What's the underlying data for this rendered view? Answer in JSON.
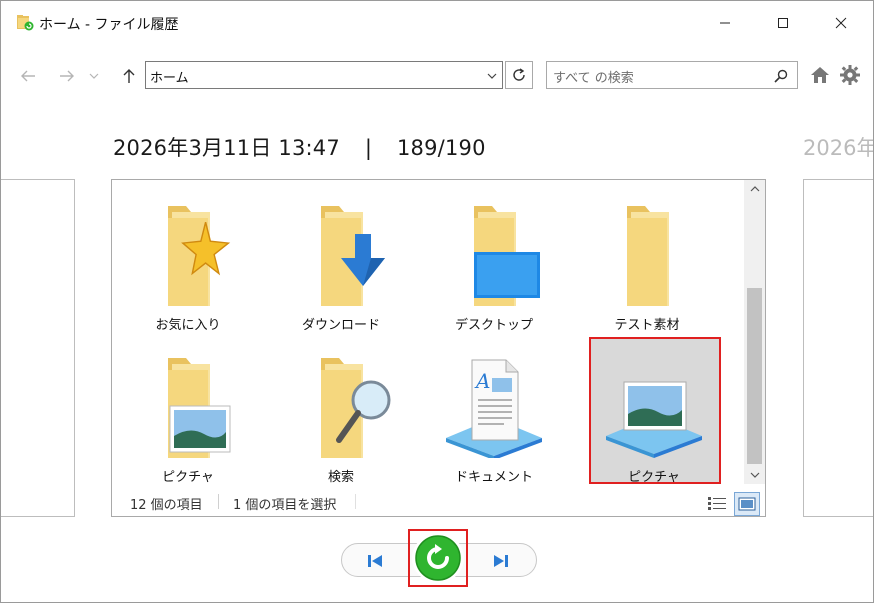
{
  "window": {
    "title": "ホーム - ファイル履歴"
  },
  "nav": {
    "address": "ホーム",
    "search_placeholder": "すべて の検索"
  },
  "snapshot": {
    "datetime": "2026年3月11日 13:47",
    "separator": "|",
    "position": "189/190",
    "next_preview": "2026年"
  },
  "items": [
    {
      "label": "お気に入り",
      "icon": "favorites-folder-icon"
    },
    {
      "label": "ダウンロード",
      "icon": "downloads-folder-icon"
    },
    {
      "label": "デスクトップ",
      "icon": "desktop-folder-icon"
    },
    {
      "label": "テスト素材",
      "icon": "folder-icon"
    },
    {
      "label": "ピクチャ",
      "icon": "pictures-folder-icon"
    },
    {
      "label": "検索",
      "icon": "search-folder-icon"
    },
    {
      "label": "ドキュメント",
      "icon": "documents-library-icon"
    },
    {
      "label": "ピクチャ",
      "icon": "pictures-library-icon",
      "selected": true
    }
  ],
  "status": {
    "count": "12 個の項目",
    "selection": "1 個の項目を選択"
  },
  "colors": {
    "folder": "#f5d77e",
    "folder_dark": "#e9c25f",
    "highlight": "#e02020",
    "restore_green": "#2fb52f",
    "accent_blue": "#2b7bd3"
  }
}
